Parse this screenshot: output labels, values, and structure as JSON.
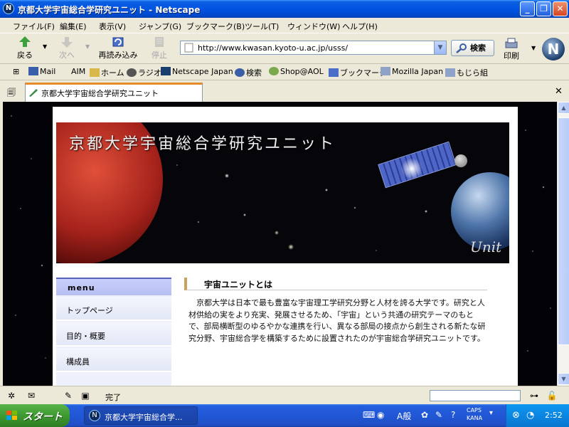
{
  "window": {
    "title": "京都大学宇宙総合学研究ユニット - Netscape"
  },
  "menubar": [
    "ファイル(F)",
    "編集(E)",
    "表示(V)",
    "ジャンプ(G)",
    "ブックマーク(B)",
    "ツール(T)",
    "ウィンドウ(W)",
    "ヘルプ(H)"
  ],
  "nav": {
    "back": "戻る",
    "forward": "次へ",
    "reload": "再読み込み",
    "stop": "停止",
    "url": "http://www.kwasan.kyoto-u.ac.jp/usss/",
    "search": "検索",
    "print": "印刷"
  },
  "bookmarks": [
    "Mail",
    "AIM",
    "ホーム",
    "ラジオ",
    "Netscape Japan",
    "検索",
    "Shop@AOL",
    "ブックマーク",
    "Mozilla Japan",
    "もじら組"
  ],
  "tab": {
    "title": "京都大学宇宙総合学研究ユニット"
  },
  "page": {
    "banner_title": "京都大学宇宙総合学研究ユニット",
    "banner_unit": "Unit",
    "menu_heading": "menu",
    "menu_items": [
      "トップページ",
      "目的・概要",
      "構成員"
    ],
    "section_title": "宇宙ユニットとは",
    "section_body": "京都大学は日本で最も豊富な宇宙理工学研究分野と人材を誇る大学です。研究と人材供給の実をより充実、発展させるため、「宇宙」という共通の研究テーマのもとで、部局横断型のゆるやかな連携を行い、異なる部局の接点から創生される新たな研究分野、宇宙総合学を構築するために設置されたのが宇宙総合学研究ユニットです。"
  },
  "status": {
    "text": "完了"
  },
  "taskbar": {
    "start": "スタート",
    "task": "京都大学宇宙総合学...",
    "ime_mode": "A般",
    "caps": "CAPS",
    "kana": "KANA",
    "clock": "2:52"
  }
}
